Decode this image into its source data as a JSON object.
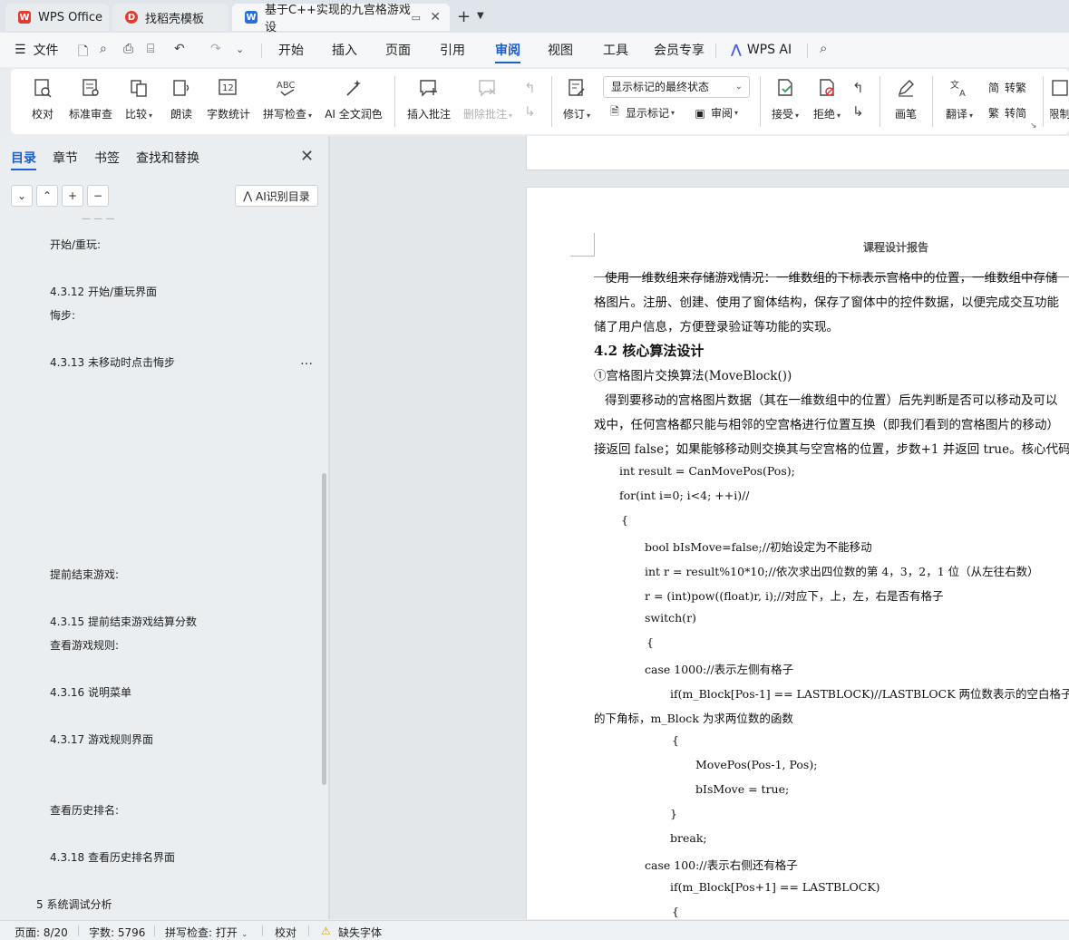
{
  "tabs": [
    {
      "label": "WPS Office",
      "icon": "wps-logo-icon",
      "color": "#e03c31"
    },
    {
      "label": "找稻壳模板",
      "icon": "docer-logo-icon",
      "color": "#e03c31"
    },
    {
      "label": "基于C++实现的九宫格游戏 设",
      "icon": "writer-logo-icon",
      "color": "#2b6ed9"
    }
  ],
  "menu": {
    "file": "文件",
    "items": [
      "开始",
      "插入",
      "页面",
      "引用",
      "审阅",
      "视图",
      "工具",
      "会员专享"
    ],
    "active": "审阅",
    "wps_ai": "WPS AI"
  },
  "ribbon": {
    "proofread": "校对",
    "standard_review": "标准审查",
    "compare": "比较",
    "read_aloud": "朗读",
    "word_count": "字数统计",
    "spell_check": "拼写检查",
    "ai_polish": "AI 全文润色",
    "insert_comment": "插入批注",
    "delete_comment": "删除批注",
    "track_changes": "修订",
    "markup_state": "显示标记的最终状态",
    "show_markup": "显示标记",
    "reviewing_pane": "审阅",
    "accept": "接受",
    "reject": "拒绝",
    "pen": "画笔",
    "translate": "翻译",
    "to_simplified_to_traditional": "转繁",
    "to_traditional_to_simplified": "转简",
    "restrict": "限制"
  },
  "nav": {
    "tabs": [
      "目录",
      "章节",
      "书签",
      "查找和替换"
    ],
    "active": "目录",
    "ai_toc": "AI识别目录",
    "toc_items": [
      {
        "text": "开始/重玩:",
        "level": 2
      },
      {
        "text": "4.3.12  开始/重玩界面",
        "level": 3
      },
      {
        "text": "悔步:",
        "level": 2
      },
      {
        "text": "4.3.13  未移动时点击悔步",
        "level": 3
      },
      {
        "text": "提前结束游戏:",
        "level": 2
      },
      {
        "text": "4.3.15  提前结束游戏结算分数",
        "level": 3
      },
      {
        "text": "查看游戏规则:",
        "level": 2
      },
      {
        "text": "4.3.16  说明菜单",
        "level": 3
      },
      {
        "text": "4.3.17  游戏规则界面",
        "level": 3
      },
      {
        "text": "查看历史排名:",
        "level": 2
      },
      {
        "text": "4.3.18  查看历史排名界面",
        "level": 3
      },
      {
        "text": "5  系统调试分析",
        "level": 1
      }
    ]
  },
  "document": {
    "header": "课程设计报告",
    "lines": [
      "使用一维数组来存储游戏情况：一维数组的下标表示宫格中的位置，一维数组中存储",
      "格图片。注册、创建、使用了窗体结构，保存了窗体中的控件数据，以便完成交互功能",
      "储了用户信息，方便登录验证等功能的实现。"
    ],
    "section_heading": "4.2 核心算法设计",
    "subheading": "①宫格图片交换算法(MoveBlock())",
    "para2": [
      "得到要移动的宫格图片数据（其在一维数组中的位置）后先判断是否可以移动及可以",
      "戏中，任何宫格都只能与相邻的空宫格进行位置互换（即我们看到的宫格图片的移动）",
      "接返回 false；如果能够移动则交换其与空宫格的位置，步数+1 并返回 true。核心代码"
    ],
    "code": [
      "int result = CanMovePos(Pos);",
      "for(int i=0; i<4; ++i)//",
      "{",
      "bool bIsMove=false;//初始设定为不能移动",
      "int r = result%10*10;//依次求出四位数的第 4，3，2，1 位（从左往右数）",
      "r = (int)pow((float)r, i);//对应下，上，左，右是否有格子",
      "switch(r)",
      "{",
      "case 1000://表示左侧有格子",
      "if(m_Block[Pos-1] == LASTBLOCK)//LASTBLOCK 两位数表示的空白格子",
      "的下角标，m_Block 为求两位数的函数",
      "{",
      "MovePos(Pos-1, Pos);",
      "bIsMove = true;",
      "}",
      "break;",
      "case 100://表示右侧还有格子",
      "if(m_Block[Pos+1] == LASTBLOCK)",
      "{"
    ]
  },
  "status": {
    "page": "页面: 8/20",
    "words": "字数: 5796",
    "spell": "拼写检查: 打开",
    "proof": "校对",
    "missing_font": "缺失字体"
  }
}
